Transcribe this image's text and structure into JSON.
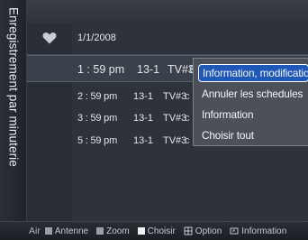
{
  "screen": {
    "side_title": "Enregistrement par minuterie"
  },
  "list": {
    "date": "1/1/2008",
    "selected": {
      "time": "1 : 59 pm",
      "channel": "13-1",
      "program": "TV#3",
      "rest": "c"
    },
    "rows": [
      {
        "time": "2 : 59 pm",
        "channel": "13-1",
        "program": "TV#3",
        "rest": "c"
      },
      {
        "time": "3 : 59 pm",
        "channel": "13-1",
        "program": "TV#3",
        "rest": "c"
      },
      {
        "time": "5 : 59 pm",
        "channel": "13-1",
        "program": "TV#3",
        "rest": "c"
      }
    ]
  },
  "popup": {
    "items": [
      "Information, modification",
      "Annuler les schedules",
      "Information",
      "Choisir tout"
    ]
  },
  "bottom_bar": {
    "air": "Air",
    "antenna": "Antenne",
    "zoom": "Zoom",
    "choose": "Choisir",
    "option": "Option",
    "information": "Information"
  }
}
